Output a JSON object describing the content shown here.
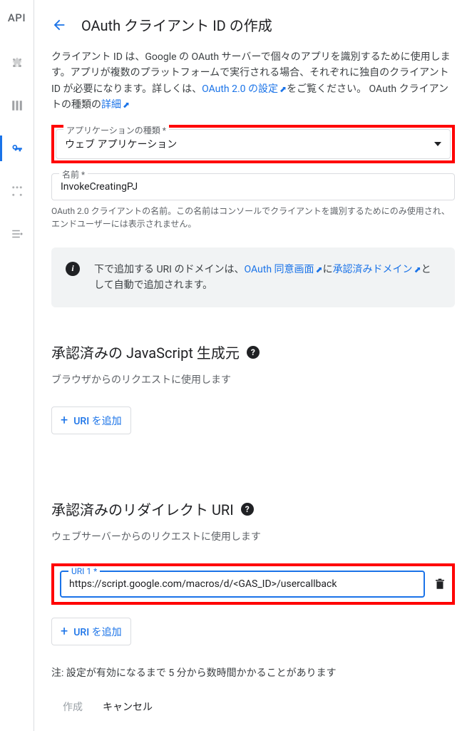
{
  "sidebar": {
    "logo": "API"
  },
  "header": {
    "title": "OAuth クライアント ID の作成"
  },
  "intro": {
    "text_before": "クライアント ID は、Google の OAuth サーバーで個々のアプリを識別するために使用します。アプリが複数のプラットフォームで実行される場合、それぞれに独自のクライアント ID が必要になります。詳しくは、",
    "link1": "OAuth 2.0 の設定",
    "text_mid": "をご覧ください。 OAuth クライアントの種類の",
    "link2": "詳細"
  },
  "app_type": {
    "label": "アプリケーションの種類 *",
    "value": "ウェブ アプリケーション"
  },
  "name_field": {
    "label": "名前 *",
    "value": "InvokeCreatingPJ",
    "helper": "OAuth 2.0 クライアントの名前。この名前はコンソールでクライアントを識別するためにのみ使用され、エンドユーザーには表示されません。"
  },
  "info": {
    "before": "下で追加する URI のドメインは、",
    "link1": "OAuth 同意画面",
    "mid": "に",
    "link2": "承認済みドメイン",
    "after": "として自動で追加されます。"
  },
  "js_section": {
    "title": "承認済みの JavaScript 生成元",
    "desc": "ブラウザからのリクエストに使用します",
    "add_btn": "URI を追加"
  },
  "redirect_section": {
    "title": "承認済みのリダイレクト URI",
    "desc": "ウェブサーバーからのリクエストに使用します",
    "uri1_label": "URI 1 *",
    "uri1_value": "https://script.google.com/macros/d/<GAS_ID>/usercallback",
    "add_btn": "URI を追加"
  },
  "note": "注: 設定が有効になるまで 5 分から数時間かかることがあります",
  "actions": {
    "create": "作成",
    "cancel": "キャンセル"
  }
}
